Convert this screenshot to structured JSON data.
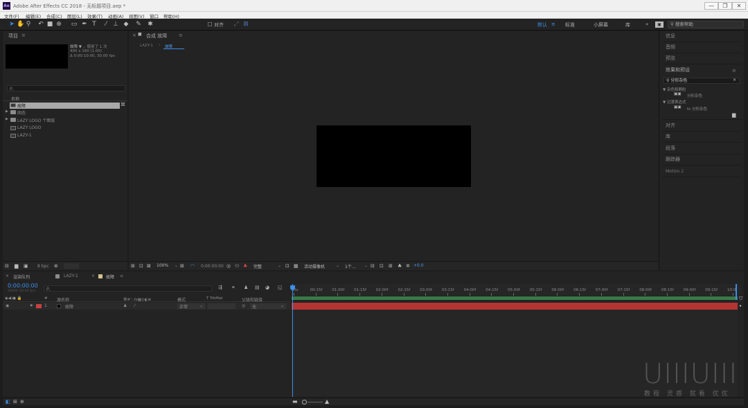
{
  "window": {
    "title": "Adobe After Effects CC 2018 - 无标题项目.aep *",
    "logo": "Ae",
    "minimize": "—",
    "restore": "❐",
    "close": "✕"
  },
  "menu": [
    "文件(F)",
    "编辑(E)",
    "合成(C)",
    "图层(L)",
    "效果(T)",
    "动画(A)",
    "视图(V)",
    "窗口",
    "帮助(H)"
  ],
  "toolbar": {
    "snap_label": "对齐",
    "workspaces": [
      "默认",
      "标准",
      "小屏幕",
      "库"
    ],
    "more": "»",
    "search_placeholder": "搜索帮助"
  },
  "project": {
    "title": "项目",
    "menu_icon": "≡",
    "preview_name": "故障 ▼",
    "preview_used": "，使用了 1 次",
    "preview_size": "400 x 160 (1.00)",
    "preview_duration": "Δ 0:00:10:00, 30.00 fps",
    "search_icon": "ρ‸",
    "column_name": "名称",
    "items": [
      {
        "name": "故障",
        "type": "comp",
        "selected": true
      },
      {
        "name": "固态",
        "type": "folder"
      },
      {
        "name": "LAZY LOGO 个图层",
        "type": "folder"
      },
      {
        "name": "LAZY LOGO",
        "type": "comp"
      },
      {
        "name": "LAZY-1",
        "type": "comp"
      }
    ],
    "bpc": "8 bpc"
  },
  "composition": {
    "tab_label": "合成 故障",
    "tab_menu": "≡",
    "breadcrumb": [
      "LAZY-1",
      "故障"
    ],
    "zoom": "100%",
    "timecode": "0:00:00:00",
    "resolution": "完整",
    "camera": "活动摄像机",
    "views": "1个…",
    "exposure": "+0.0"
  },
  "right_panel": {
    "items_top": [
      "信息",
      "音频",
      "预览"
    ],
    "effects_title": "效果和预设",
    "effects_menu": "≡",
    "effects_search": "分形杂色",
    "effects_tree": [
      {
        "label": "▼ 杂色和颗粒",
        "child": "分形杂色"
      },
      {
        "label": "▼ 过渡表达式",
        "child": "fx 分形杂色"
      }
    ],
    "items_bottom": [
      "对齐",
      "库",
      "段落",
      "跟踪器",
      "Motion 2"
    ]
  },
  "timeline": {
    "tabs": [
      "渲染队列",
      "LAZY-1",
      "故障"
    ],
    "timecode": "0:00:00:00",
    "timecode_sub": "00000 (30.00 fps)",
    "search_icon": "ρ‸",
    "columns": {
      "switches": "◉◀)● 🔒",
      "hash": "#",
      "source_name": "源名称",
      "fx_switches": "单✲＼fx▦◎◐⊕",
      "mode": "模式",
      "trkmat": "T  TrkMat",
      "parent": "父级和链接"
    },
    "layers": [
      {
        "index": "1",
        "name": "故障",
        "mode": "正常",
        "parent": "无",
        "color": "#c84040"
      }
    ],
    "ruler": [
      "0s",
      "00:15f",
      "01:00f",
      "01:15f",
      "02:00f",
      "02:15f",
      "03:00f",
      "03:15f",
      "04:00f",
      "04:15f",
      "05:00f",
      "05:15f",
      "06:00f",
      "06:15f",
      "07:00f",
      "07:15f",
      "08:00f",
      "08:15f",
      "09:00f",
      "09:15f",
      "10:0"
    ]
  },
  "watermark": {
    "logo": "UIIIUIII",
    "text": "教程 灵感 就看 优优"
  },
  "colors": {
    "accent": "#3d8fe8",
    "layer_bar": "#b43434",
    "work_area": "#3a7a48"
  }
}
